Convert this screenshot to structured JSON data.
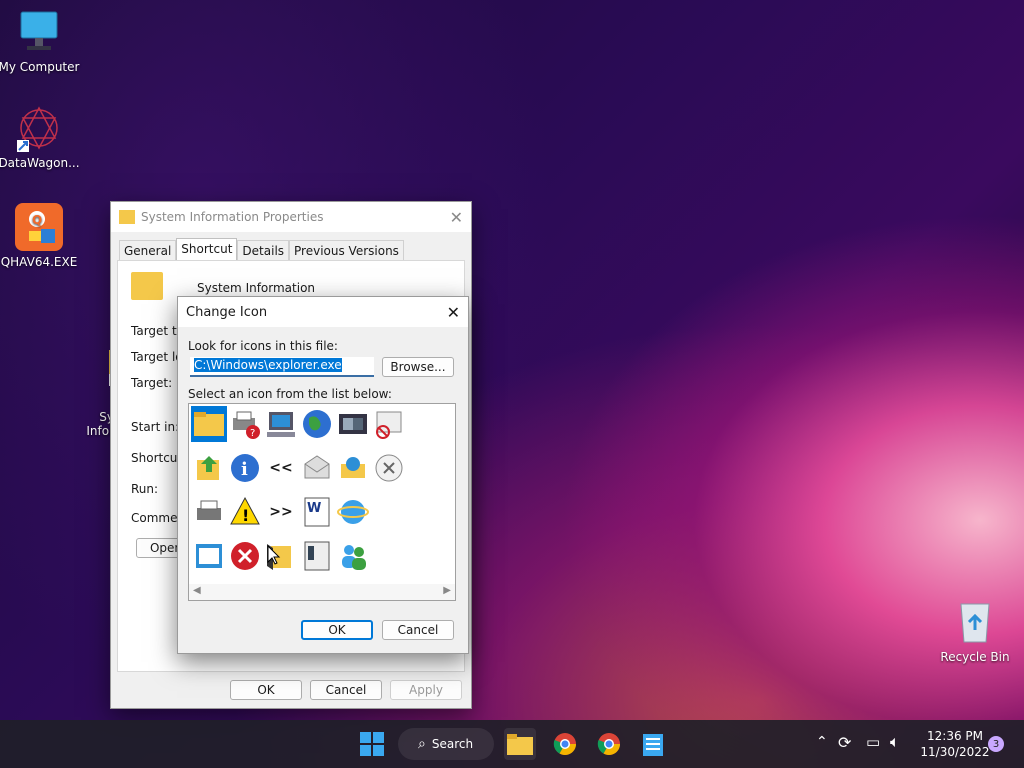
{
  "desktop": {
    "icons": [
      {
        "label": "My Computer"
      },
      {
        "label": "DataWagon..."
      },
      {
        "label": "QHAV64.EXE"
      },
      {
        "label": "Sy\nInfor"
      },
      {
        "label": "Recycle Bin"
      }
    ]
  },
  "properties": {
    "title": "System Information Properties",
    "tabs": [
      "General",
      "Shortcut",
      "Details",
      "Previous Versions"
    ],
    "active_tab": "Shortcut",
    "app_name": "System Information",
    "fields": [
      "Target typ",
      "Target loc",
      "Target:",
      "Start in:",
      "Shortcut k",
      "Run:",
      "Comment:"
    ],
    "open_label": "Open",
    "ok_label": "OK",
    "cancel_label": "Cancel",
    "apply_label": "Apply"
  },
  "change_icon": {
    "title": "Change Icon",
    "file_label": "Look for icons in this file:",
    "file_value": "C:\\Windows\\explorer.exe",
    "browse_label": "Browse...",
    "list_label": "Select an icon from the list below:",
    "icons": [
      "folder-icon",
      "printer-error-icon",
      "computer-icon",
      "globe-icon",
      "windows-icon",
      "no-entry-window-icon",
      "folder-up-icon",
      "info-icon",
      "back-arrows-icon",
      "mail-icon",
      "network-share-icon",
      "close-circle-icon",
      "printer-icon",
      "warning-icon",
      "forward-arrows-icon",
      "word-document-icon",
      "internet-icon",
      "edit-window-icon",
      "error-icon",
      "open-folder-icon",
      "server-list-icon",
      "users-icon"
    ],
    "ok_label": "OK",
    "cancel_label": "Cancel"
  },
  "taskbar": {
    "search_label": "Search",
    "time": "12:36 PM",
    "date": "11/30/2022",
    "notification_count": "3"
  }
}
